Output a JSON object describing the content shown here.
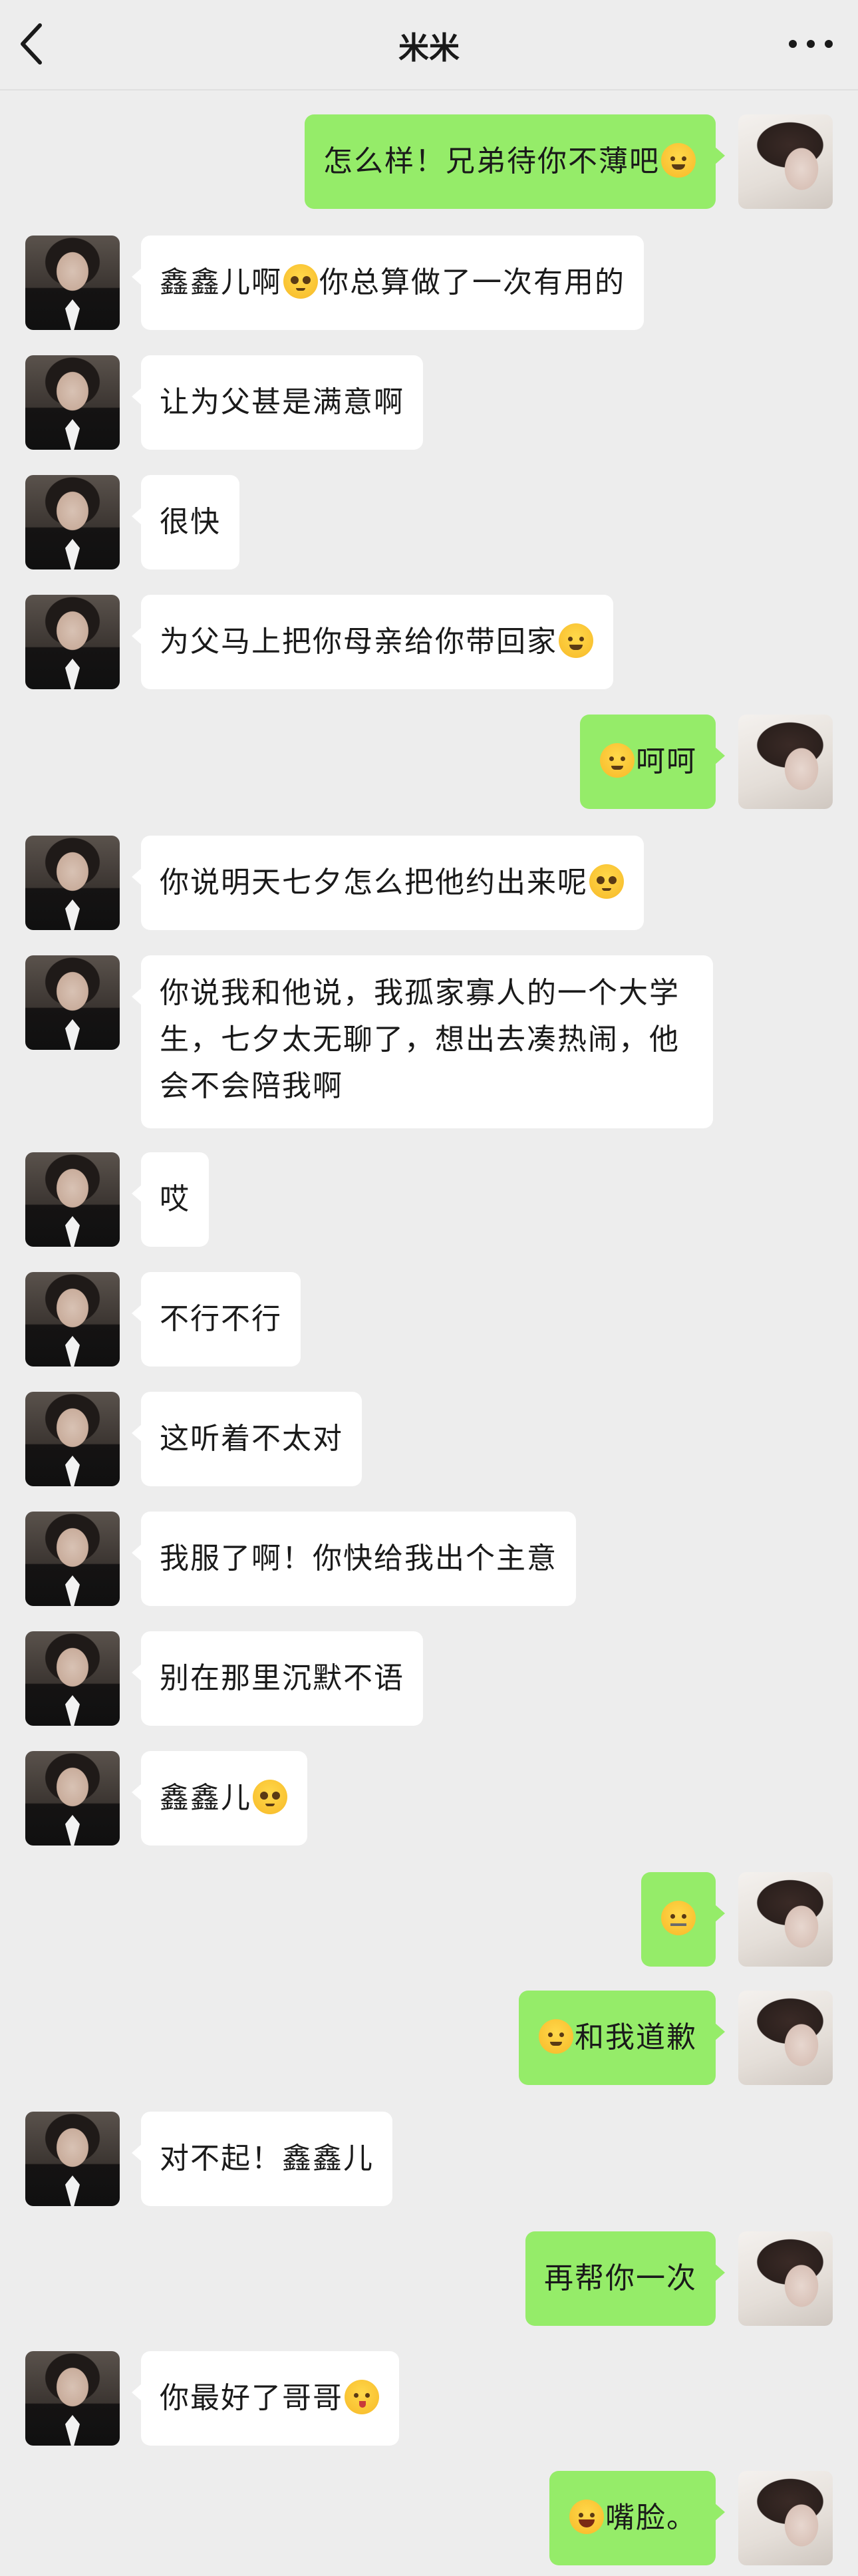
{
  "header": {
    "title": "米米",
    "back_icon": "chevron-left-icon",
    "more_icon": "ellipsis-icon"
  },
  "messages": [
    {
      "side": "right",
      "parts": [
        {
          "t": "怎么样！兄弟待你不薄吧"
        },
        {
          "e": "smiling-face-with-hearts"
        }
      ]
    },
    {
      "side": "left",
      "parts": [
        {
          "t": "鑫鑫儿啊"
        },
        {
          "e": "pleading-face"
        },
        {
          "t": "你总算做了一次有用的"
        }
      ]
    },
    {
      "side": "left",
      "parts": [
        {
          "t": "让为父甚是满意啊"
        }
      ]
    },
    {
      "side": "left",
      "parts": [
        {
          "t": "很快"
        }
      ]
    },
    {
      "side": "left",
      "parts": [
        {
          "t": "为父马上把你母亲给你带回家"
        },
        {
          "e": "smiling-face-with-hearts"
        }
      ]
    },
    {
      "side": "right",
      "parts": [
        {
          "e": "upside-down-face"
        },
        {
          "t": "呵呵"
        }
      ]
    },
    {
      "side": "left",
      "parts": [
        {
          "t": "你说明天七夕怎么把他约出来呢"
        },
        {
          "e": "pleading-face"
        }
      ]
    },
    {
      "side": "left",
      "parts": [
        {
          "t": "你说我和他说，我孤家寡人的一个大学生，七夕太无聊了，想出去凑热闹，他会不会陪我啊"
        }
      ]
    },
    {
      "side": "left",
      "parts": [
        {
          "t": "哎"
        }
      ]
    },
    {
      "side": "left",
      "parts": [
        {
          "t": "不行不行"
        }
      ]
    },
    {
      "side": "left",
      "parts": [
        {
          "t": "这听着不太对"
        }
      ]
    },
    {
      "side": "left",
      "parts": [
        {
          "t": "我服了啊！你快给我出个主意"
        }
      ]
    },
    {
      "side": "left",
      "parts": [
        {
          "t": "别在那里沉默不语"
        }
      ]
    },
    {
      "side": "left",
      "parts": [
        {
          "t": "鑫鑫儿"
        },
        {
          "e": "pleading-face"
        }
      ]
    },
    {
      "side": "right",
      "parts": [
        {
          "e": "zipper-mouth-face"
        }
      ]
    },
    {
      "side": "right",
      "parts": [
        {
          "e": "smiley-face"
        },
        {
          "t": "和我道歉"
        }
      ]
    },
    {
      "side": "left",
      "parts": [
        {
          "t": "对不起！鑫鑫儿"
        }
      ]
    },
    {
      "side": "right",
      "parts": [
        {
          "t": "再帮你一次"
        }
      ]
    },
    {
      "side": "left",
      "parts": [
        {
          "t": "你最好了哥哥"
        },
        {
          "e": "face-blowing-a-kiss"
        }
      ]
    },
    {
      "side": "right",
      "parts": [
        {
          "e": "face-with-tears-of-joy"
        },
        {
          "t": "嘴脸。"
        }
      ]
    }
  ],
  "colors": {
    "background": "#ededed",
    "incoming_bubble": "#ffffff",
    "outgoing_bubble": "#95ec69",
    "text": "#1a1a1a"
  }
}
